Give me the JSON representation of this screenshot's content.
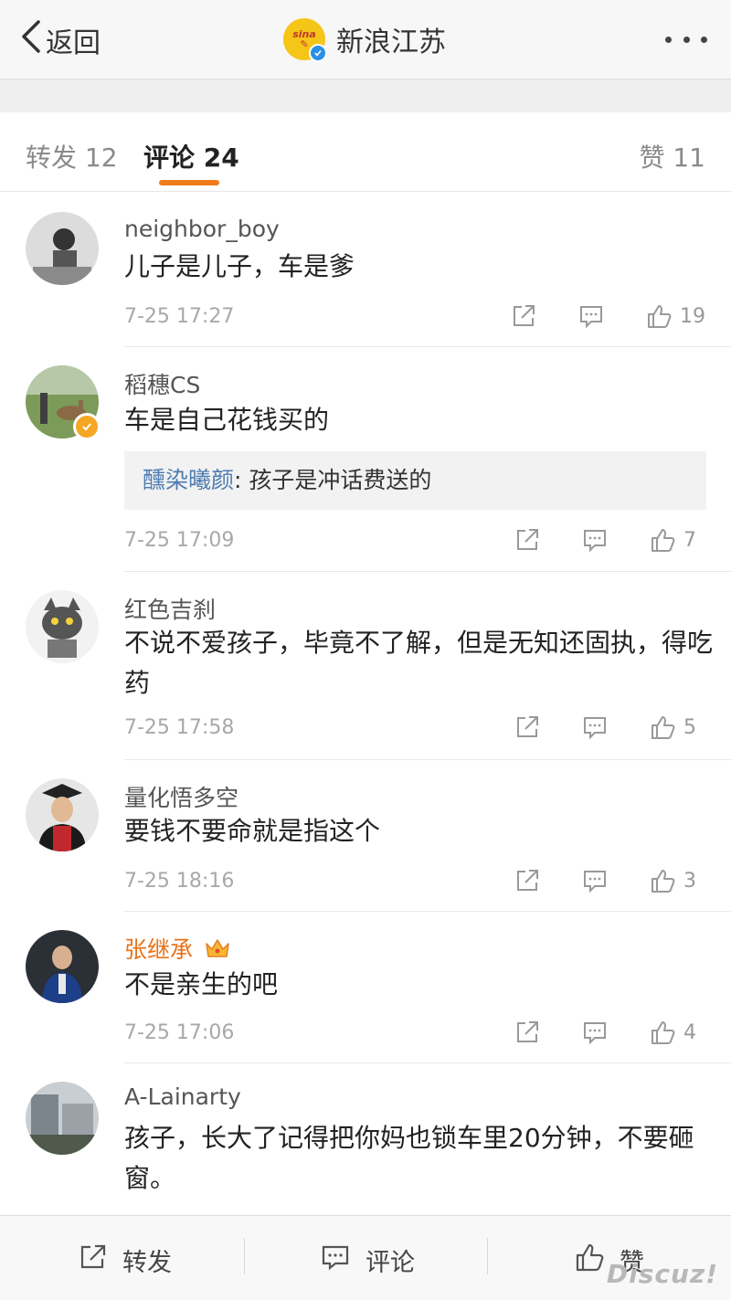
{
  "header": {
    "back_label": "返回",
    "account_name": "新浪江苏"
  },
  "tabs": [
    {
      "label": "转发 12"
    },
    {
      "label": "评论 24"
    },
    {
      "label": "赞 11"
    }
  ],
  "comments": [
    {
      "user": "neighbor_boy",
      "text": "儿子是儿子，车是爹",
      "time": "7-25 17:27",
      "likes": "19"
    },
    {
      "user": "稻穗CS",
      "text": "车是自己花钱买的",
      "reply_user": "醺染曦颜",
      "reply_text": ": 孩子是冲话费送的",
      "time": "7-25 17:09",
      "likes": "7"
    },
    {
      "user": "红色吉刹",
      "text": "不说不爱孩子，毕竟不了解，但是无知还固执，得吃药",
      "time": "7-25 17:58",
      "likes": "5"
    },
    {
      "user": "量化悟多空",
      "text": "要钱不要命就是指这个",
      "time": "7-25 18:16",
      "likes": "3"
    },
    {
      "user": "张继承",
      "text": "不是亲生的吧",
      "time": "7-25 17:06",
      "likes": "4"
    },
    {
      "user": "A-Lainarty",
      "text": "孩子，长大了记得把你妈也锁车里20分钟，不要砸窗。",
      "time": "",
      "likes": ""
    }
  ],
  "bottom_bar": {
    "repost": "转发",
    "comment": "评论",
    "like": "赞"
  },
  "watermark": "Discuz!",
  "colors": {
    "accent": "#f07b1a",
    "reply_name": "#4e7cb2",
    "vip_name": "#e8721a"
  }
}
